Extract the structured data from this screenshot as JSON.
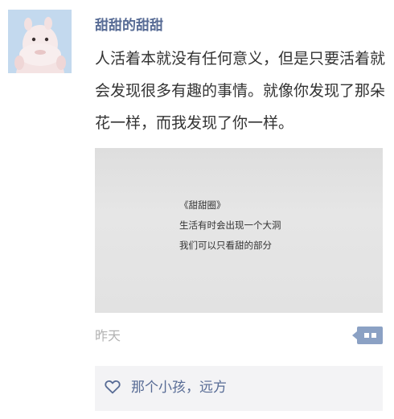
{
  "post": {
    "username": "甜甜的甜甜",
    "text": "人活着本就没有任何意义，但是只要活着就会发现很多有趣的事情。就像你发现了那朵花一样，而我发现了你一样。",
    "image_text": {
      "title": "《甜甜圈》",
      "line1": "生活有时会出现一个大洞",
      "line2": "我们可以只看甜的部分"
    },
    "time": "昨天"
  },
  "likes": {
    "names": "那个小孩，远方"
  },
  "icons": {
    "avatar": "pink-plush-toy-avatar",
    "comment": "comment-dots-icon",
    "like": "heart-outline-icon"
  },
  "colors": {
    "name_link": "#576b95",
    "comment_button": "#8ba1c4",
    "likes_bg": "#f3f3f5",
    "timestamp": "#b2b2b2"
  }
}
